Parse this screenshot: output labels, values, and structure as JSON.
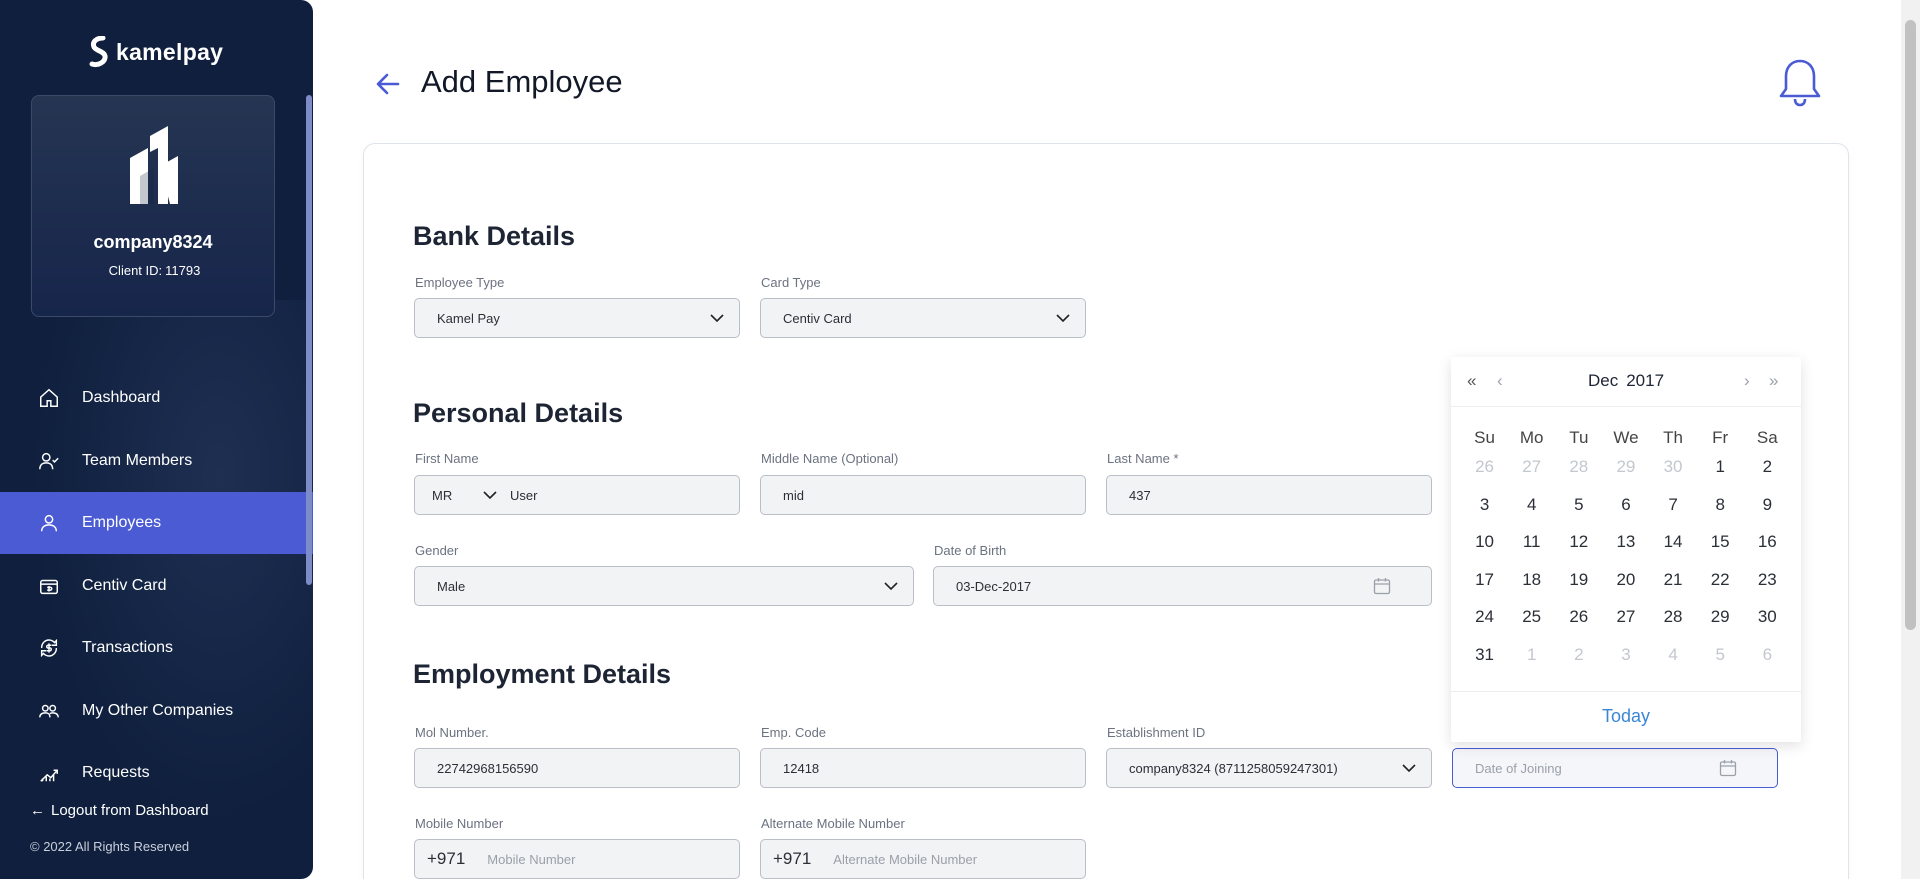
{
  "sidebar": {
    "brand": "kamelpay",
    "company_name": "company8324",
    "client_id_label": "Client ID:",
    "client_id": "11793",
    "nav": [
      {
        "label": "Dashboard",
        "icon": "home-icon"
      },
      {
        "label": "Team Members",
        "icon": "user-check-icon"
      },
      {
        "label": "Employees",
        "icon": "user-icon",
        "active": true
      },
      {
        "label": "Centiv Card",
        "icon": "card-dollar-icon"
      },
      {
        "label": "Transactions",
        "icon": "dollar-refresh-icon"
      },
      {
        "label": "My Other Companies",
        "icon": "users-icon"
      },
      {
        "label": "Requests",
        "icon": "chart-icon"
      }
    ],
    "logout": "Logout from Dashboard",
    "copyright": "© 2022 All Rights Reserved"
  },
  "header": {
    "title": "Add Employee"
  },
  "bank": {
    "title": "Bank Details",
    "employee_type_label": "Employee Type",
    "employee_type_value": "Kamel Pay",
    "card_type_label": "Card Type",
    "card_type_value": "Centiv Card"
  },
  "personal": {
    "title": "Personal Details",
    "first_name_label": "First Name",
    "title_value": "MR",
    "first_name_value": "User",
    "middle_name_label": "Middle Name (Optional)",
    "middle_name_value": "mid",
    "last_name_label": "Last Name *",
    "last_name_value": "437",
    "gender_label": "Gender",
    "gender_value": "Male",
    "dob_label": "Date of Birth",
    "dob_value": "03-Dec-2017"
  },
  "employment": {
    "title": "Employment Details",
    "mol_label": "Mol Number.",
    "mol_value": "22742968156590",
    "emp_code_label": "Emp. Code",
    "emp_code_value": "12418",
    "establishment_label": "Establishment ID",
    "establishment_value": "company8324 (8711258059247301)",
    "doj_placeholder": "Date of Joining",
    "mobile_label": "Mobile Number",
    "mobile_prefix": "+971",
    "mobile_placeholder": "Mobile Number",
    "alt_mobile_label": "Alternate Mobile Number",
    "alt_mobile_prefix": "+971",
    "alt_mobile_placeholder": "Alternate Mobile Number"
  },
  "datepicker": {
    "month": "Dec",
    "year": "2017",
    "prev_year": "«",
    "prev_month": "‹",
    "next_month": "›",
    "next_year": "»",
    "weekdays": [
      "Su",
      "Mo",
      "Tu",
      "We",
      "Th",
      "Fr",
      "Sa"
    ],
    "weeks": [
      [
        {
          "d": "26",
          "m": true
        },
        {
          "d": "27",
          "m": true
        },
        {
          "d": "28",
          "m": true
        },
        {
          "d": "29",
          "m": true
        },
        {
          "d": "30",
          "m": true
        },
        {
          "d": "1"
        },
        {
          "d": "2"
        }
      ],
      [
        {
          "d": "3"
        },
        {
          "d": "4"
        },
        {
          "d": "5"
        },
        {
          "d": "6"
        },
        {
          "d": "7"
        },
        {
          "d": "8"
        },
        {
          "d": "9"
        }
      ],
      [
        {
          "d": "10"
        },
        {
          "d": "11"
        },
        {
          "d": "12"
        },
        {
          "d": "13"
        },
        {
          "d": "14"
        },
        {
          "d": "15"
        },
        {
          "d": "16"
        }
      ],
      [
        {
          "d": "17"
        },
        {
          "d": "18"
        },
        {
          "d": "19"
        },
        {
          "d": "20"
        },
        {
          "d": "21"
        },
        {
          "d": "22"
        },
        {
          "d": "23"
        }
      ],
      [
        {
          "d": "24"
        },
        {
          "d": "25"
        },
        {
          "d": "26"
        },
        {
          "d": "27"
        },
        {
          "d": "28"
        },
        {
          "d": "29"
        },
        {
          "d": "30"
        }
      ],
      [
        {
          "d": "31"
        },
        {
          "d": "1",
          "m": true
        },
        {
          "d": "2",
          "m": true
        },
        {
          "d": "3",
          "m": true
        },
        {
          "d": "4",
          "m": true
        },
        {
          "d": "5",
          "m": true
        },
        {
          "d": "6",
          "m": true
        }
      ]
    ],
    "today": "Today"
  },
  "colors": {
    "sidebar_bg": "#0f1f3d",
    "accent": "#4a5bd4",
    "link": "#3a86d4"
  }
}
